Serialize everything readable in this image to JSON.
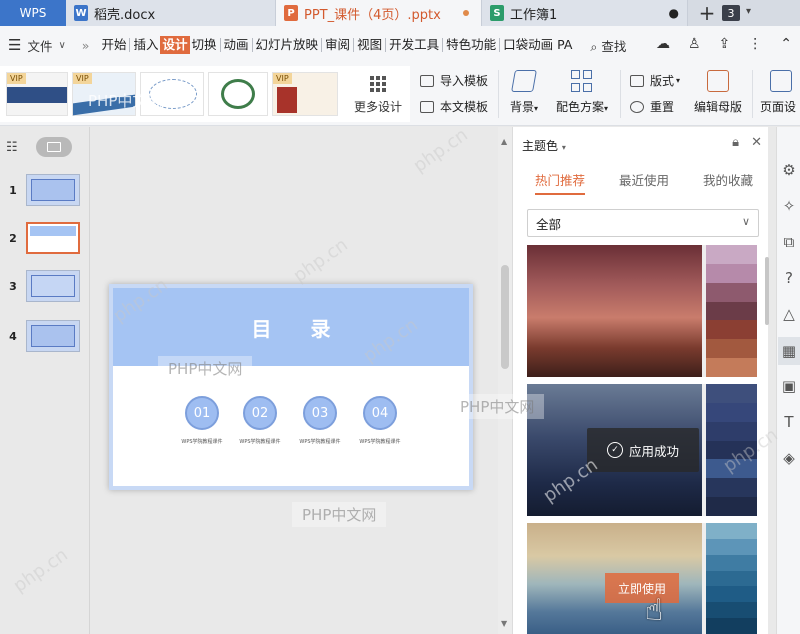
{
  "tabs": {
    "app_name": "WPS",
    "doc1": {
      "name": "稻壳.docx",
      "icon": "W"
    },
    "doc2": {
      "name": "PPT_课件（4页）.pptx",
      "icon": "P"
    },
    "doc3": {
      "name": "工作簿1",
      "icon": "S"
    },
    "new_tab": "+",
    "tab_count": "3"
  },
  "menu": {
    "file": "文件",
    "items": [
      "开始",
      "插入",
      "设计",
      "切换",
      "动画",
      "幻灯片放映",
      "审阅",
      "视图",
      "开发工具",
      "特色功能",
      "口袋动画 PA"
    ],
    "active_index": 2,
    "search": "查找"
  },
  "ribbon": {
    "template_vip_badge": "VIP",
    "more_design": "更多设计",
    "import_template": "导入模板",
    "text_template": "本文模板",
    "background": "背景",
    "color_scheme": "配色方案",
    "layout": "版式",
    "reset": "重置",
    "edit_master": "编辑母版",
    "page_setup": "页面设"
  },
  "slides": {
    "numbers": [
      "1",
      "2",
      "3",
      "4"
    ],
    "selected_index": 1
  },
  "slide": {
    "title": "目 录",
    "items": [
      {
        "num": "01",
        "caption": "WPS学院教程课件"
      },
      {
        "num": "02",
        "caption": "WPS学院教程课件"
      },
      {
        "num": "03",
        "caption": "WPS学院教程课件"
      },
      {
        "num": "04",
        "caption": "WPS学院教程课件"
      }
    ]
  },
  "theme_panel": {
    "title": "主题色",
    "tabs": [
      "热门推荐",
      "最近使用",
      "我的收藏"
    ],
    "active_tab": 0,
    "filter": "全部",
    "applied_label": "应用成功",
    "use_label": "立即使用",
    "card1_swatches": [
      "#c9a9c4",
      "#b68aaa",
      "#8e5a6e",
      "#6b3c48",
      "#8b3f33",
      "#a2593f",
      "#c47b5a"
    ],
    "card2_swatches": [
      "#3e4f7c",
      "#36477a",
      "#2e3d6a",
      "#253258",
      "#3d5a8e",
      "#27365c",
      "#1f2a48"
    ],
    "card3_swatches": [
      "#7fb0c8",
      "#5d95b8",
      "#3f7ca3",
      "#2c6a92",
      "#1f5c86",
      "#184d72",
      "#123e5f"
    ]
  },
  "watermarks": [
    "PHP中文网",
    "php.cn"
  ]
}
